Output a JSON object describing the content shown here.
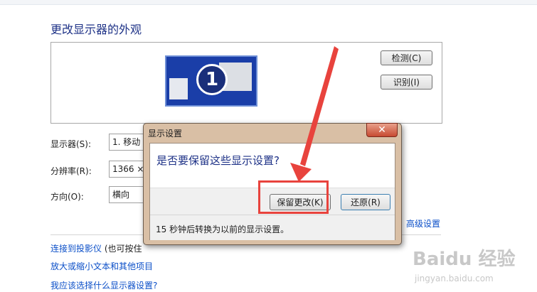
{
  "page": {
    "title": "更改显示器的外观",
    "detect_button": "检测(C)",
    "identify_button": "识别(I)",
    "monitor_number": "1",
    "display_label": "显示器(S):",
    "display_value": "1. 移动",
    "resolution_label": "分辨率(R):",
    "resolution_value": "1366 ×",
    "orientation_label": "方向(O):",
    "orientation_value": "横向",
    "advanced_link": "高级设置",
    "projector_link": "连接到投影仪",
    "projector_suffix": "(也可按住",
    "text_size_link": "放大或缩小文本和其他项目",
    "help_link": "我应该选择什么显示器设置?"
  },
  "dialog": {
    "title": "显示设置",
    "close_glyph": "✕",
    "question": "是否要保留这些显示设置?",
    "keep_button": "保留更改(K)",
    "revert_button": "还原(R)",
    "countdown_text": "15 秒钟后转换为以前的显示设置。"
  },
  "watermark": {
    "brand": "Baidu 经验",
    "url": "jingyan.baidu.com"
  },
  "colors": {
    "annotation_red": "#e8433d",
    "title_blue": "#1e3287",
    "link_blue": "#0b4fc8"
  }
}
